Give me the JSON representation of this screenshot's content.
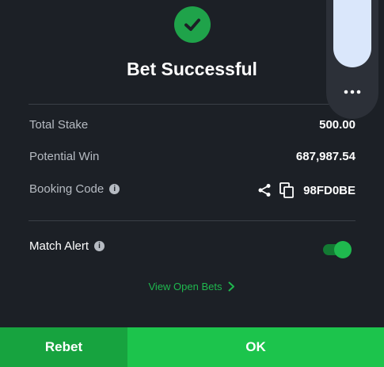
{
  "header": {
    "title": "Bet Successful",
    "success_icon": "check-circle-icon"
  },
  "summary": {
    "rows": [
      {
        "label": "Total Stake",
        "value": "500.00"
      },
      {
        "label": "Potential Win",
        "value": "687,987.54"
      },
      {
        "label": "Booking Code",
        "value": "98FD0BE"
      }
    ]
  },
  "match_alert": {
    "label": "Match Alert",
    "enabled": true
  },
  "links": {
    "view_open_bets": "View Open Bets"
  },
  "actions": {
    "rebet": "Rebet",
    "ok": "OK"
  },
  "colors": {
    "background": "#1c2026",
    "accent_green": "#1fb84e",
    "rebet_green": "#17a33f",
    "ok_green": "#1cc44c",
    "scroll_thumb": "#dae7fb"
  }
}
